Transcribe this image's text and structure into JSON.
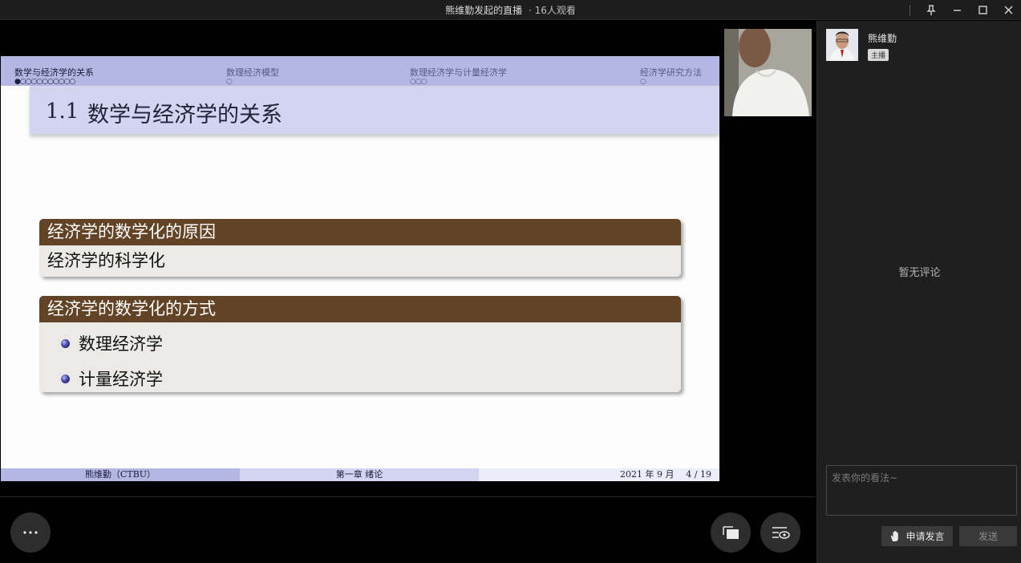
{
  "window": {
    "title": "熊维勤发起的直播",
    "viewers": "· 16人观看"
  },
  "slide": {
    "nav": [
      {
        "label": "数学与经济学的关系",
        "dots": "●○○○○○○○○○○"
      },
      {
        "label": "数理经济模型",
        "dots": "○"
      },
      {
        "label": "数理经济学与计量经济学",
        "dots": "○○○"
      },
      {
        "label": "经济学研究方法",
        "dots": "○"
      }
    ],
    "section_number": "1.1",
    "title": "数学与经济学的关系",
    "block1": {
      "heading": "经济学的数学化的原因",
      "body": "经济学的科学化"
    },
    "block2": {
      "heading": "经济学的数学化的方式",
      "items": [
        "数理经济学",
        "计量经济学"
      ]
    },
    "footer": {
      "author": "熊维勤（CTBU）",
      "chapter": "第一章   绪论",
      "date": "2021 年 9 月",
      "page": "4 / 19"
    }
  },
  "panel": {
    "host_name": "熊维勤",
    "host_badge": "主播",
    "empty_comments": "暂无评论",
    "comment_placeholder": "发表你的看法~",
    "apply_speak": "申请发言",
    "send": "发送"
  },
  "icons": {
    "pin": "pin-icon",
    "minimize": "minimize-icon",
    "maximize": "maximize-icon",
    "close": "close-icon",
    "more": "more-icon",
    "screen": "screen-switch-icon",
    "view_settings": "view-settings-icon",
    "hand": "raise-hand-icon"
  }
}
